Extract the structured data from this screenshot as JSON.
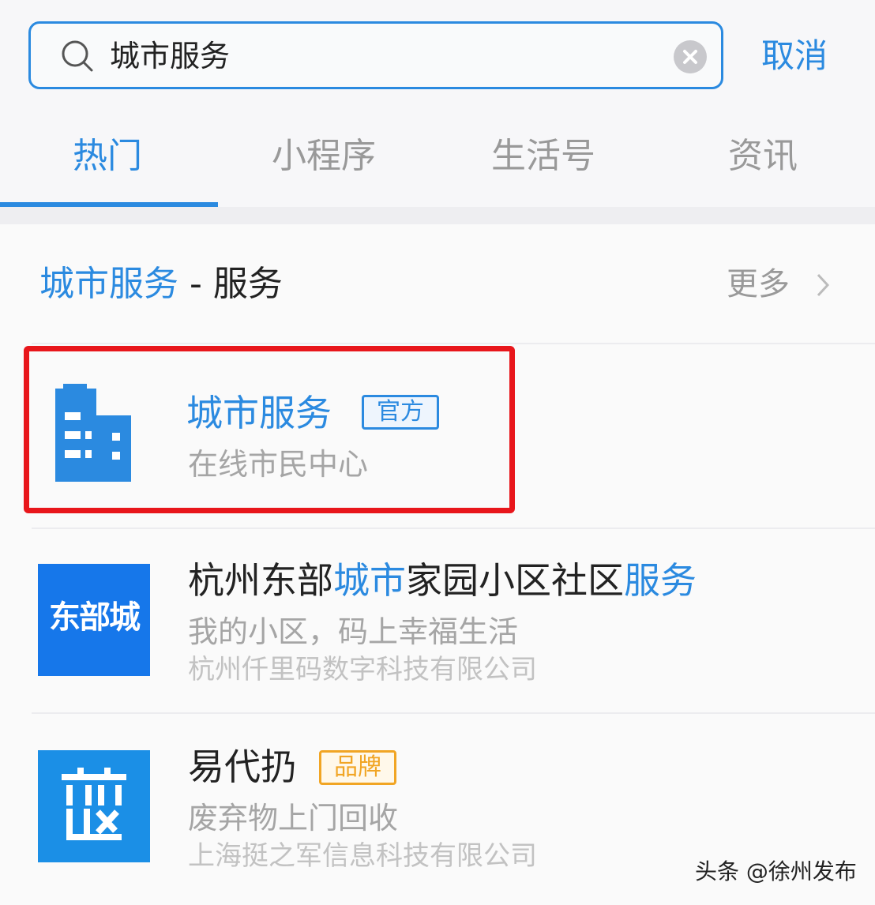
{
  "search": {
    "query": "城市服务",
    "cancel_label": "取消"
  },
  "tabs": [
    {
      "label": "热门",
      "active": true
    },
    {
      "label": "小程序",
      "active": false
    },
    {
      "label": "生活号",
      "active": false
    },
    {
      "label": "资讯",
      "active": false
    }
  ],
  "section": {
    "title_highlight": "城市服务",
    "title_rest": " - 服务",
    "more_label": "更多"
  },
  "results": [
    {
      "title": "城市服务",
      "badge": "官方",
      "subtitle": "在线市民中心",
      "icon": "building-icon"
    },
    {
      "title_parts": [
        "杭州东部",
        "城市",
        "家园小区社区",
        "服务"
      ],
      "subtitle": "我的小区，码上幸福生活",
      "company": "杭州仟里码数字科技有限公司",
      "logo_text": "东部城"
    },
    {
      "title": "易代扔",
      "badge": "品牌",
      "subtitle": "废弃物上门回收",
      "company": "上海挺之军信息科技有限公司",
      "icon": "recycle-logo-icon"
    }
  ],
  "watermark": "头条 @徐州发布",
  "colors": {
    "accent": "#2b8ae0",
    "highlight_border": "#e8161b",
    "brand_badge": "#f1a524"
  }
}
